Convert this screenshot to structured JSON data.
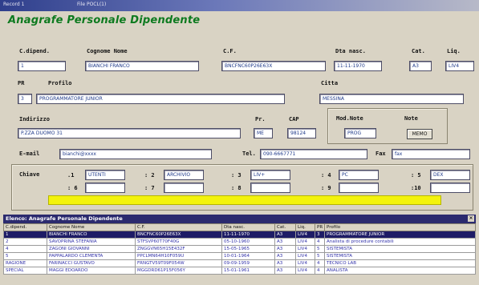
{
  "window": {
    "title_left": "Record 1",
    "title_right": "File POCL(1)"
  },
  "form": {
    "title": "Anagrafe Personale Dipendente"
  },
  "fields": {
    "cod_dipend": {
      "label": "C.dipend.",
      "value": "1"
    },
    "cognome_nome": {
      "label": "Cognome Nome",
      "value": "BIANCHI FRANCO"
    },
    "cf": {
      "label": "C.F.",
      "value": "BNCFNC60P26E63X"
    },
    "dta_nasc": {
      "label": "Dta nasc.",
      "value": "11-11-1970"
    },
    "cat": {
      "label": "Cat.",
      "value": "A3"
    },
    "liq": {
      "label": "Liq.",
      "value": "LIV4"
    },
    "pr_code": {
      "label": "PR",
      "value": "3"
    },
    "profilo": {
      "label": "Profilo",
      "value": "PROGRAMMATORE JUNIOR"
    },
    "citta": {
      "label": "Citta",
      "value": "MESSINA"
    },
    "indirizzo": {
      "label": "Indirizzo",
      "value": "P.ZZA DUOMO 31"
    },
    "pr": {
      "label": "Pr.",
      "value": "ME"
    },
    "cap": {
      "label": "CAP",
      "value": "98124"
    },
    "mod_note": {
      "label": "Mod.Note",
      "value": "PROG"
    },
    "note": {
      "label": "Note",
      "button": "MEMO"
    },
    "email": {
      "label": "E-mail",
      "value": "bianchi@xxxx"
    },
    "tel": {
      "label": "Tel.",
      "value": "090-6667771"
    },
    "fax": {
      "label": "Fax",
      "value": "fax"
    }
  },
  "chiave": {
    "label": "Chiave",
    "slots": [
      {
        "label": ".1",
        "value": "UTENTI"
      },
      {
        "label": ": 2",
        "value": "ARCHIVIO"
      },
      {
        "label": ": 3",
        "value": "LIV+"
      },
      {
        "label": ": 4",
        "value": "PC"
      },
      {
        "label": ": 5",
        "value": "DEX"
      },
      {
        "label": ": 6",
        "value": ""
      },
      {
        "label": ": 7",
        "value": ""
      },
      {
        "label": ": 8",
        "value": ""
      },
      {
        "label": ": 9",
        "value": ""
      },
      {
        "label": ":10",
        "value": ""
      }
    ]
  },
  "grid": {
    "title": "Elenco: Anagrafe Personale Dipendente",
    "close": "×",
    "columns": [
      "C.dipend.",
      "Cognome Nome",
      "C.F.",
      "Dta nasc.",
      "Cat.",
      "Liq.",
      "PR",
      "Profilo"
    ],
    "rows": [
      [
        "1",
        "BIANCHI FRANCO",
        "BNCFNC60P26E63X",
        "11-11-1970",
        "A3",
        "LIV4",
        "3",
        "PROGRAMMATORE JUNIOR"
      ],
      [
        "2",
        "SAVOPRINA STEFANIA",
        "STFSVP60T70F40G",
        "05-10-1960",
        "A3",
        "LIV4",
        "4",
        "Analista di procedure contabili"
      ],
      [
        "4",
        "ZAGONI GIOVANNI",
        "ZNGGVN65H15E432F",
        "15-05-1965",
        "A3",
        "LIV4",
        "5",
        "SISTEMISTA"
      ],
      [
        "5",
        "PAPPALARDO CLEMENTA",
        "PPCLMN64H10F059U",
        "10-01-1964",
        "A3",
        "LIV4",
        "5",
        "SISTEMISTA"
      ],
      [
        "RAGIONE",
        "FARINACCI GUSTAVO",
        "FRNGTV59T09F054W",
        "09-09-1959",
        "A3",
        "LIV4",
        "4",
        "TECNICO LAB"
      ],
      [
        "SPECIAL",
        "MAGGI EDOARDO",
        "MGGDRD61P15F056Y",
        "15-01-1961",
        "A3",
        "LIV4",
        "4",
        "ANALISTA"
      ]
    ]
  }
}
